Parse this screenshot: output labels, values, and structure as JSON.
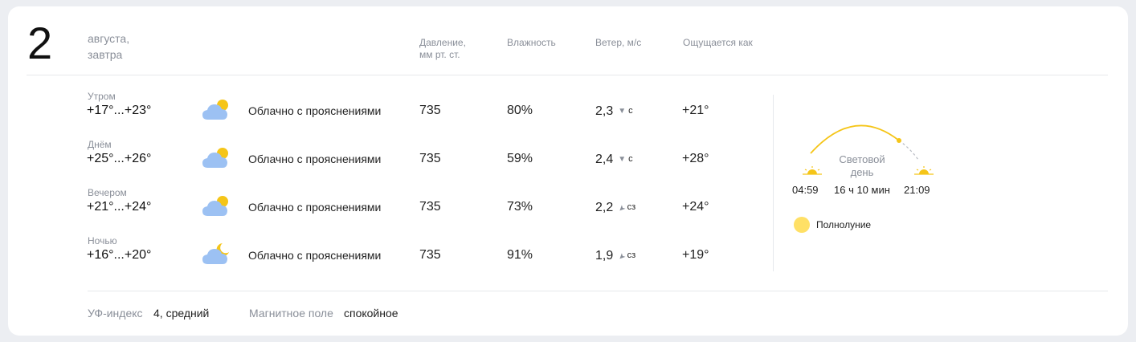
{
  "day": {
    "number": "2",
    "month": "августа,",
    "relative": "завтра"
  },
  "columns": {
    "pressure": [
      "Давление,",
      "мм рт. ст."
    ],
    "humidity": "Влажность",
    "wind": "Ветер, м/с",
    "feels": "Ощущается как"
  },
  "rows": [
    {
      "period": "Утром",
      "temp": "+17°...+23°",
      "icon": "partly-cloudy-day-icon",
      "condition": "Облачно с прояснениями",
      "pressure": "735",
      "humidity": "80%",
      "wind_speed": "2,3",
      "wind_dir": "с",
      "feels": "+21°"
    },
    {
      "period": "Днём",
      "temp": "+25°...+26°",
      "icon": "partly-cloudy-day-icon",
      "condition": "Облачно с прояснениями",
      "pressure": "735",
      "humidity": "59%",
      "wind_speed": "2,4",
      "wind_dir": "с",
      "feels": "+28°"
    },
    {
      "period": "Вечером",
      "temp": "+21°...+24°",
      "icon": "partly-cloudy-day-icon",
      "condition": "Облачно с прояснениями",
      "pressure": "735",
      "humidity": "73%",
      "wind_speed": "2,2",
      "wind_dir": "сз",
      "feels": "+24°"
    },
    {
      "period": "Ночью",
      "temp": "+16°...+20°",
      "icon": "partly-cloudy-night-icon",
      "condition": "Облачно с прояснениями",
      "pressure": "735",
      "humidity": "91%",
      "wind_speed": "1,9",
      "wind_dir": "сз",
      "feels": "+19°"
    }
  ],
  "sun": {
    "sunrise": "04:59",
    "sunset": "21:09",
    "day_label": [
      "Световой",
      "день"
    ],
    "day_length": "16 ч 10 мин"
  },
  "moon": {
    "phase": "Полнолуние",
    "color": "#ffe066"
  },
  "footer": {
    "uv_label": "УФ-индекс",
    "uv_value": "4, средний",
    "magnetic_label": "Магнитное поле",
    "magnetic_value": "спокойное"
  },
  "colors": {
    "sun": "#f5c518",
    "cloud": "#9cc1f3",
    "muted": "#8a8f99"
  }
}
